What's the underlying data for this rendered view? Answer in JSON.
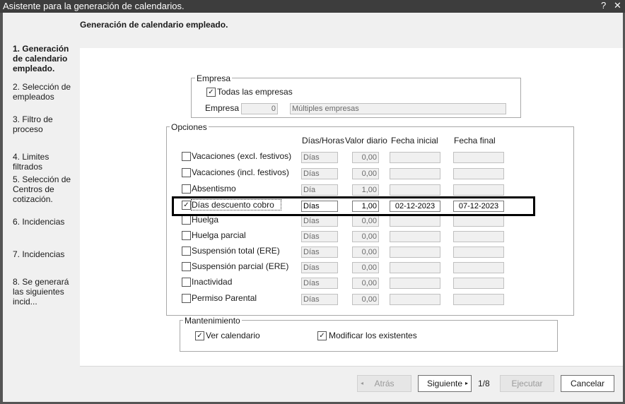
{
  "window": {
    "title": "Asistente para la generación de calendarios.",
    "help": "?",
    "close": "✕"
  },
  "header": {
    "title": "Generación de calendario empleado."
  },
  "steps": [
    {
      "label": "1. Generación de calendario empleado."
    },
    {
      "label": "2. Selección de empleados"
    },
    {
      "label": "3. Filtro de proceso"
    },
    {
      "label": "4. Limites filtrados"
    },
    {
      "label": "5. Selección de Centros de cotización."
    },
    {
      "label": "6. Incidencias"
    },
    {
      "label": "7. Incidencias"
    },
    {
      "label": "8. Se generará las siguientes incid..."
    }
  ],
  "empresa": {
    "legend": "Empresa",
    "todas_label": "Todas las empresas",
    "todas_checked": true,
    "field_label": "Empresa",
    "code": "0",
    "name": "Múltiples empresas"
  },
  "opciones": {
    "legend": "Opciones",
    "columns": {
      "dias_horas": "Días/Horas",
      "valor_diario": "Valor diario",
      "fecha_inicial": "Fecha inicial",
      "fecha_final": "Fecha final"
    },
    "rows": [
      {
        "label": "Vacaciones (excl. festivos)",
        "unit": "Días",
        "valor": "0,00",
        "fecha_inicial": "",
        "fecha_final": "",
        "checked": false
      },
      {
        "label": "Vacaciones (incl. festivos)",
        "unit": "Días",
        "valor": "0,00",
        "fecha_inicial": "",
        "fecha_final": "",
        "checked": false
      },
      {
        "label": "Absentismo",
        "unit": "Día",
        "valor": "1,00",
        "fecha_inicial": "",
        "fecha_final": "",
        "checked": false
      },
      {
        "label": "Días descuento cobro",
        "unit": "Días",
        "valor": "1,00",
        "fecha_inicial": "02-12-2023",
        "fecha_final": "07-12-2023",
        "checked": true
      },
      {
        "label": "Huelga",
        "unit": "Días",
        "valor": "0,00",
        "fecha_inicial": "",
        "fecha_final": "",
        "checked": false
      },
      {
        "label": "Huelga parcial",
        "unit": "Días",
        "valor": "0,00",
        "fecha_inicial": "",
        "fecha_final": "",
        "checked": false
      },
      {
        "label": "Suspensión total (ERE)",
        "unit": "Días",
        "valor": "0,00",
        "fecha_inicial": "",
        "fecha_final": "",
        "checked": false
      },
      {
        "label": "Suspensión parcial (ERE)",
        "unit": "Días",
        "valor": "0,00",
        "fecha_inicial": "",
        "fecha_final": "",
        "checked": false
      },
      {
        "label": "Inactividad",
        "unit": "Días",
        "valor": "0,00",
        "fecha_inicial": "",
        "fecha_final": "",
        "checked": false
      },
      {
        "label": "Permiso Parental",
        "unit": "Días",
        "valor": "0,00",
        "fecha_inicial": "",
        "fecha_final": "",
        "checked": false
      }
    ]
  },
  "mantenimiento": {
    "legend": "Mantenimiento",
    "ver_calendario": "Ver calendario",
    "ver_checked": true,
    "modificar": "Modificar los existentes",
    "modificar_checked": true
  },
  "footer": {
    "atras": "Atrás",
    "siguiente": "Siguiente",
    "pager": "1/8",
    "ejecutar": "Ejecutar",
    "cancelar": "Cancelar"
  },
  "check_glyph": "✓"
}
